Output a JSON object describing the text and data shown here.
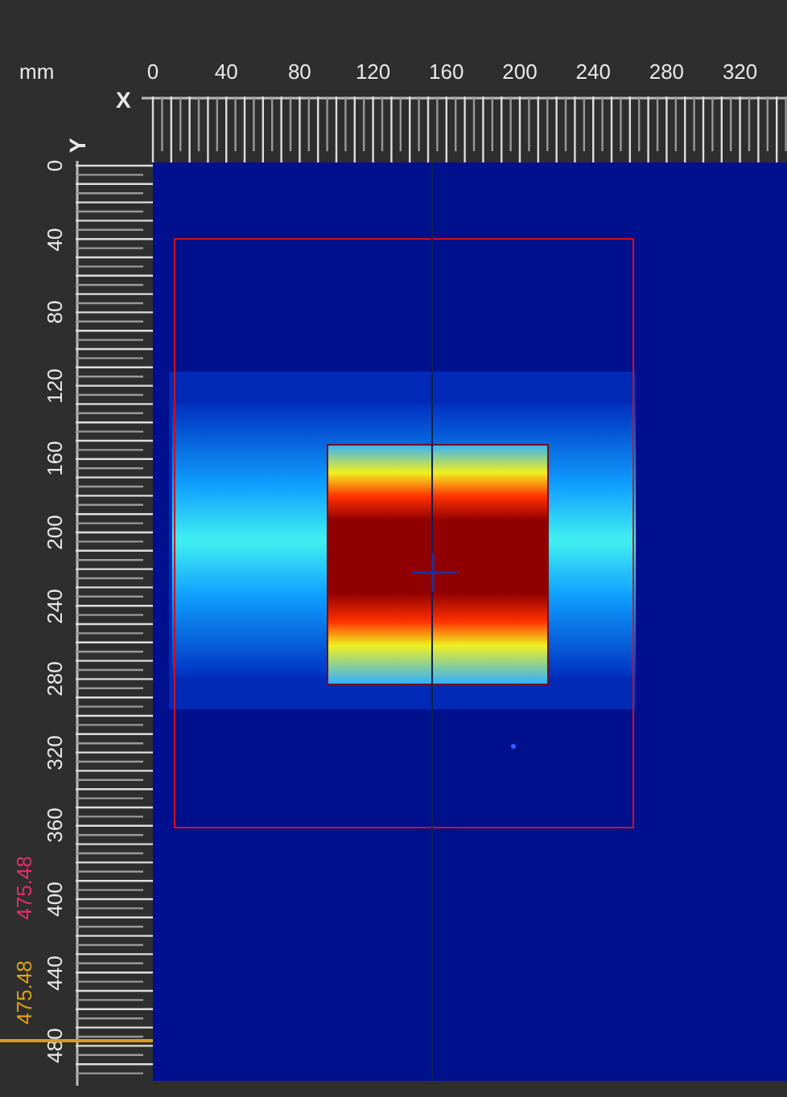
{
  "units": "mm",
  "x_axis": {
    "label": "X",
    "ticks": [
      "0",
      "40",
      "80",
      "120",
      "160",
      "200",
      "240",
      "280",
      "320"
    ]
  },
  "y_axis": {
    "label": "Y",
    "ticks": [
      "0",
      "40",
      "80",
      "120",
      "160",
      "200",
      "240",
      "280",
      "320",
      "360",
      "400",
      "440",
      "480"
    ]
  },
  "readouts": [
    {
      "text": "475.48",
      "color": "#e0306a"
    },
    {
      "text": "475.48",
      "color": "#e0a020"
    }
  ]
}
